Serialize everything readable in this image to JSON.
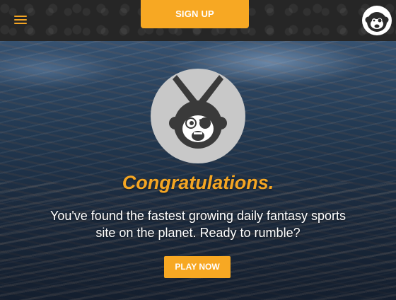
{
  "header": {
    "signup_label": "SIGN UP",
    "menu_icon": "hamburger-menu-icon",
    "logo_icon": "monkey-logo-icon"
  },
  "hero": {
    "headline": "Congratulations.",
    "tagline": "You've found the fastest growing daily fantasy sports site on the planet. Ready to rumble?",
    "cta_label": "PLAY NOW",
    "emblem_icon": "monkey-crossed-swords-emblem-icon"
  },
  "colors": {
    "accent": "#f7a823",
    "header_bg": "#262626",
    "text": "#ffffff"
  }
}
